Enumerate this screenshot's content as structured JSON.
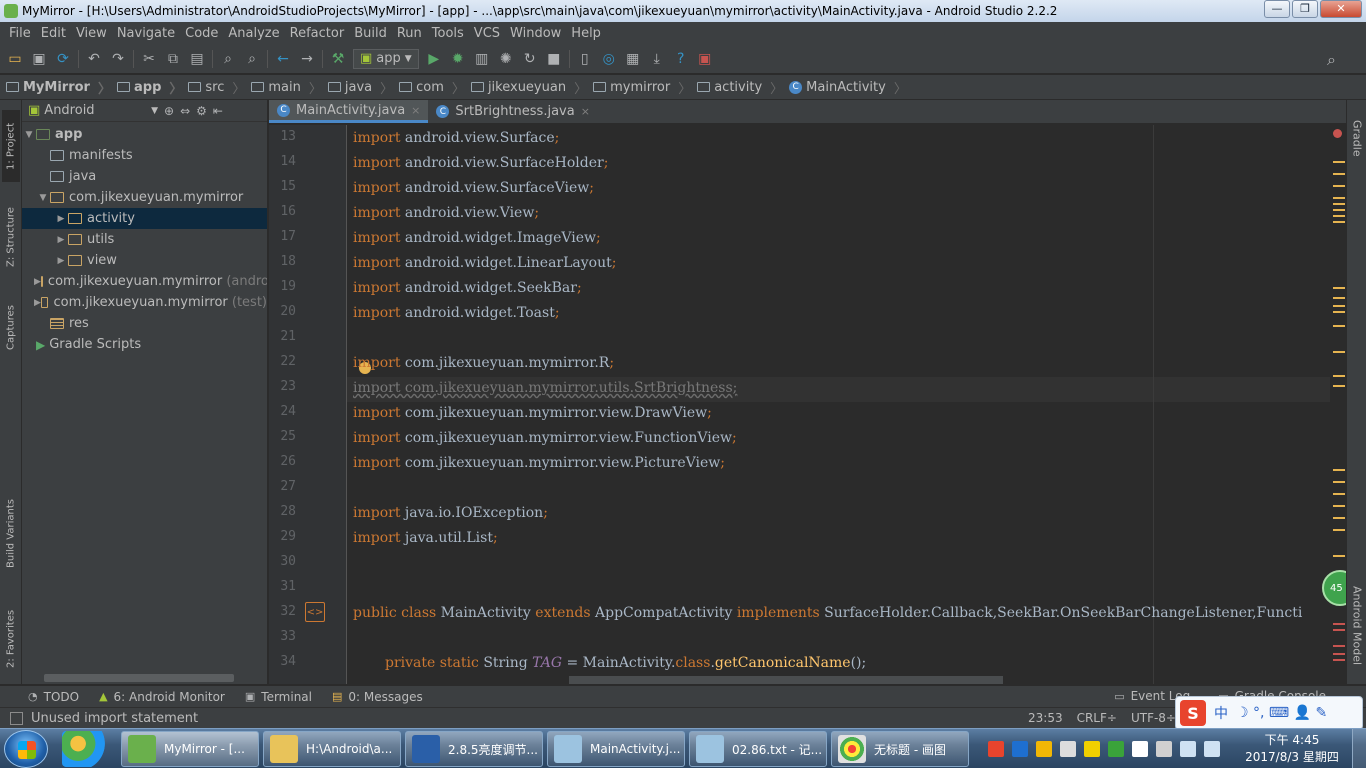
{
  "window": {
    "title": "MyMirror - [H:\\Users\\Administrator\\AndroidStudioProjects\\MyMirror] - [app] - ...\\app\\src\\main\\java\\com\\jikexueyuan\\mymirror\\activity\\MainActivity.java - Android Studio 2.2.2",
    "minimize": "—",
    "maximize": "❐",
    "close": "✕"
  },
  "menu": [
    "File",
    "Edit",
    "View",
    "Navigate",
    "Code",
    "Analyze",
    "Refactor",
    "Build",
    "Run",
    "Tools",
    "VCS",
    "Window",
    "Help"
  ],
  "toolbar": {
    "run_config": "app"
  },
  "breadcrumb": [
    "MyMirror",
    "app",
    "src",
    "main",
    "java",
    "com",
    "jikexueyuan",
    "mymirror",
    "activity",
    "MainActivity"
  ],
  "left_strip": {
    "project": "1: Project",
    "structure": "Z: Structure",
    "captures": "Captures",
    "build_variants": "Build Variants",
    "favorites": "2: Favorites"
  },
  "right_strip": {
    "gradle": "Gradle",
    "android_model": "Android Model"
  },
  "project_panel": {
    "view": "Android",
    "tree": [
      {
        "label": "app",
        "suffix": ""
      },
      {
        "label": "manifests",
        "suffix": ""
      },
      {
        "label": "java",
        "suffix": ""
      },
      {
        "label": "com.jikexueyuan.mymirror",
        "suffix": ""
      },
      {
        "label": "activity",
        "suffix": ""
      },
      {
        "label": "utils",
        "suffix": ""
      },
      {
        "label": "view",
        "suffix": ""
      },
      {
        "label": "com.jikexueyuan.mymirror",
        "suffix": "(andro"
      },
      {
        "label": "com.jikexueyuan.mymirror",
        "suffix": "(test)"
      },
      {
        "label": "res",
        "suffix": ""
      },
      {
        "label": "Gradle Scripts",
        "suffix": ""
      }
    ]
  },
  "tabs": [
    {
      "label": "MainActivity.java",
      "close": "×"
    },
    {
      "label": "SrtBrightness.java",
      "close": "×"
    }
  ],
  "editor": {
    "line_numbers": [
      "13",
      "14",
      "15",
      "16",
      "17",
      "18",
      "19",
      "20",
      "21",
      "22",
      "23",
      "24",
      "25",
      "26",
      "27",
      "28",
      "29",
      "30",
      "31",
      "32",
      "33",
      "34"
    ],
    "lines": {
      "l13": "android.view.Surface",
      "l14": "android.view.SurfaceHolder",
      "l15": "android.view.SurfaceView",
      "l16": "android.view.View",
      "l17": "android.widget.ImageView",
      "l18": "android.widget.LinearLayout",
      "l19": "android.widget.SeekBar",
      "l20": "android.widget.Toast",
      "l22": "com.jikexueyuan.mymirror.R",
      "l23": "import com.jikexueyuan.mymirror.utils.SrtBrightness;",
      "l24": "com.jikexueyuan.mymirror.view.DrawView",
      "l25": "com.jikexueyuan.mymirror.view.FunctionView",
      "l26": "com.jikexueyuan.mymirror.view.PictureView",
      "l28": "java.io.IOException",
      "l29": "java.util.List",
      "l32_a": "public class ",
      "l32_b": "MainActivity ",
      "l32_c": "extends ",
      "l32_d": "AppCompatActivity ",
      "l32_e": "implements ",
      "l32_f": "SurfaceHolder.Callback,SeekBar.OnSeekBarChangeListener,Functi",
      "l34_a": "private static ",
      "l34_b": "String ",
      "l34_c": "TAG",
      "l34_d": " = MainActivity.",
      "l34_e": "class",
      "l34_f": ".",
      "l34_g": "getCanonicalName",
      "l34_h": "();"
    },
    "keyword_import": "import",
    "semicolon": ";",
    "badge": "45"
  },
  "bottom_tools": {
    "todo": "TODO",
    "android_monitor": "6: Android Monitor",
    "terminal": "Terminal",
    "messages": "0: Messages",
    "event_log": "Event Log",
    "gradle_console": "Gradle Console"
  },
  "status": {
    "message": "Unused import statement",
    "position": "23:53",
    "line_sep": "CRLF÷",
    "encoding": "UTF-8÷"
  },
  "ime": {
    "logo": "S",
    "mode": "中",
    "items": "☽ °, ⌨ 👤 ✎"
  },
  "taskbar": {
    "tasks": [
      {
        "label": "MyMirror - [..."
      },
      {
        "label": "H:\\Android\\a..."
      },
      {
        "label": "2.8.5亮度调节..."
      },
      {
        "label": "MainActivity.j..."
      },
      {
        "label": "02.86.txt - 记..."
      },
      {
        "label": "无标题 - 画图"
      }
    ],
    "time": "下午 4:45",
    "date": "2017/8/3 星期四"
  }
}
